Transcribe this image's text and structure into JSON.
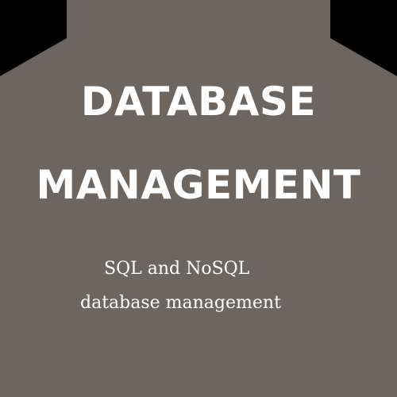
{
  "colors": {
    "background": "#6b6661",
    "corner_shapes": "#000000",
    "text": "#ffffff"
  },
  "title": {
    "line1": "DATABASE",
    "line2": "MANAGEMENT"
  },
  "subtitle": {
    "line1": "SQL and NoSQL",
    "line2": "database management"
  }
}
